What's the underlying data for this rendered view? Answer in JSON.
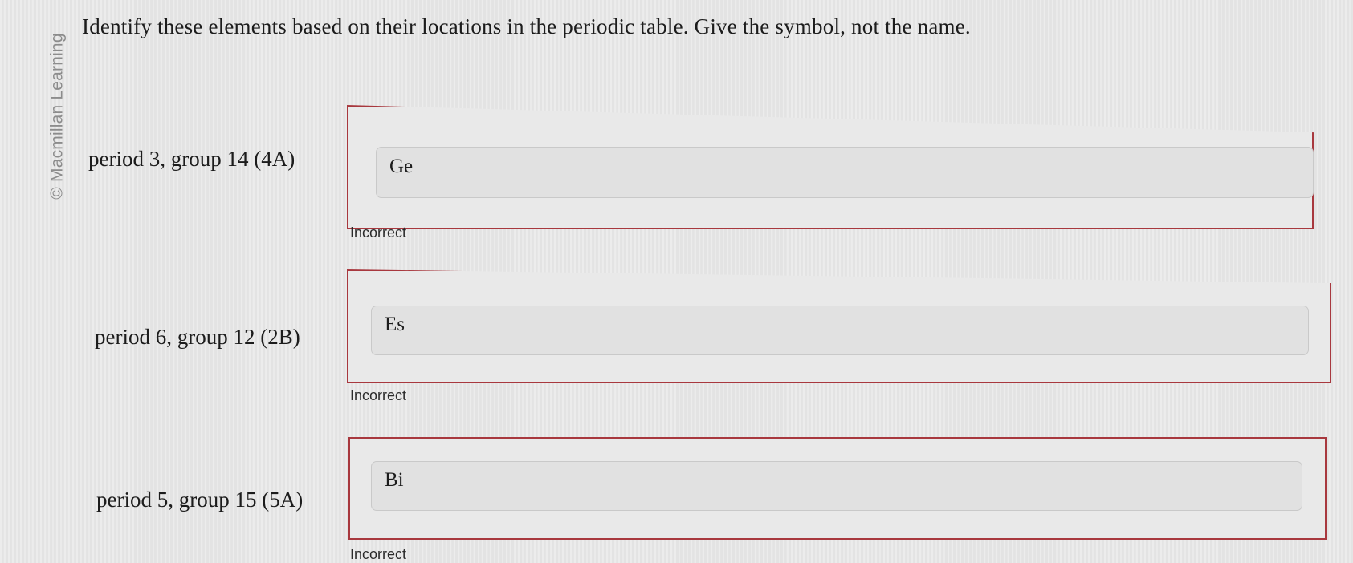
{
  "watermark": "© Macmillan Learning",
  "instructions": "Identify these elements based on their locations in the periodic table. Give the symbol, not the name.",
  "questions": [
    {
      "label": "period 3, group 14 (4A)",
      "answer": "Ge",
      "feedback": "Incorrect"
    },
    {
      "label": "period 6, group 12 (2B)",
      "answer": "Es",
      "feedback": "Incorrect"
    },
    {
      "label": "period 5, group 15 (5A)",
      "answer": "Bi",
      "feedback": "Incorrect"
    }
  ],
  "colors": {
    "incorrect_border": "#a8383e",
    "background": "#e8e8e8"
  }
}
